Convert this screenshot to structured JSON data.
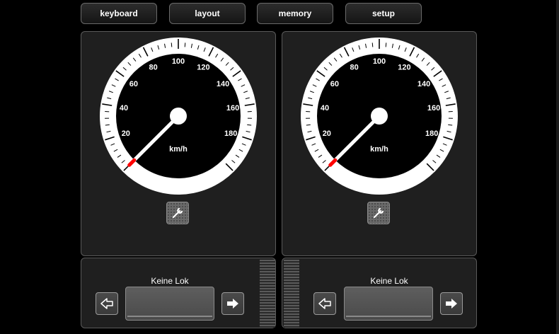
{
  "toolbar": {
    "buttons": [
      {
        "label": "keyboard"
      },
      {
        "label": "layout"
      },
      {
        "label": "memory"
      },
      {
        "label": "setup"
      }
    ]
  },
  "gauge": {
    "unit_label": "km/h",
    "tick_labels": [
      "20",
      "40",
      "60",
      "80",
      "100",
      "120",
      "140",
      "160",
      "180"
    ],
    "min": 0,
    "max": 200,
    "needle_color": "#ffffff",
    "needle_tip_color": "#ff0000"
  },
  "throttles": [
    {
      "speed": 0,
      "loco_name": "Keine Lok",
      "left_icon": "arrow-left-outline-icon",
      "right_icon": "arrow-right-solid-icon",
      "settings_icon": "wrench-icon"
    },
    {
      "speed": 0,
      "loco_name": "Keine Lok",
      "left_icon": "arrow-left-outline-icon",
      "right_icon": "arrow-right-solid-icon",
      "settings_icon": "wrench-icon"
    }
  ]
}
